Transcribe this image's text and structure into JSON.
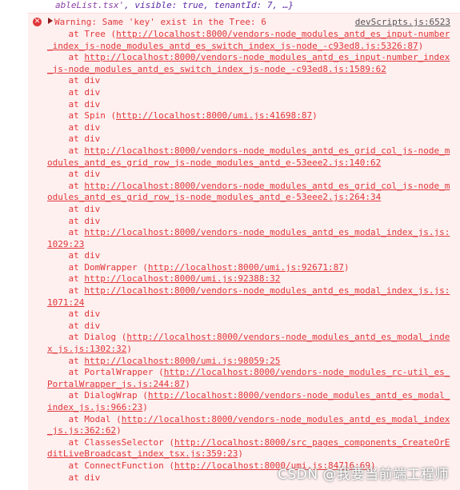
{
  "previous_line": {
    "text_a": "ableList.tsx'",
    "text_b": ", visible: true, tenantId: 7, …}"
  },
  "error": {
    "icon": "error-circle-icon",
    "headline": "Warning: Same 'key' exist in the Tree: 6",
    "source": "devScripts.js:6523",
    "frames": [
      {
        "fn": "Tree",
        "url": "http://localhost:8000/vendors-node_modules_antd_es_input-number_index_js-node_modules_antd_es_switch_index_js-node_-c93ed8.js:5326:87"
      },
      {
        "fn": "",
        "url": "http://localhost:8000/vendors-node_modules_antd_es_input-number_index_js-node_modules_antd_es_switch_index_js-node_-c93ed8.js:1589:62"
      },
      {
        "fn": "div",
        "url": ""
      },
      {
        "fn": "div",
        "url": ""
      },
      {
        "fn": "div",
        "url": ""
      },
      {
        "fn": "Spin",
        "url": "http://localhost:8000/umi.js:41698:87"
      },
      {
        "fn": "div",
        "url": ""
      },
      {
        "fn": "div",
        "url": ""
      },
      {
        "fn": "",
        "url": "http://localhost:8000/vendors-node_modules_antd_es_grid_col_js-node_modules_antd_es_grid_row_js-node_modules_antd_e-53eee2.js:140:62"
      },
      {
        "fn": "div",
        "url": ""
      },
      {
        "fn": "",
        "url": "http://localhost:8000/vendors-node_modules_antd_es_grid_col_js-node_modules_antd_es_grid_row_js-node_modules_antd_e-53eee2.js:264:34"
      },
      {
        "fn": "div",
        "url": ""
      },
      {
        "fn": "div",
        "url": ""
      },
      {
        "fn": "",
        "url": "http://localhost:8000/vendors-node_modules_antd_es_modal_index_js.js:1029:23"
      },
      {
        "fn": "div",
        "url": ""
      },
      {
        "fn": "DomWrapper",
        "url": "http://localhost:8000/umi.js:92671:87"
      },
      {
        "fn": "",
        "url": "http://localhost:8000/umi.js:92388:32"
      },
      {
        "fn": "",
        "url": "http://localhost:8000/vendors-node_modules_antd_es_modal_index_js.js:1071:24"
      },
      {
        "fn": "div",
        "url": ""
      },
      {
        "fn": "div",
        "url": ""
      },
      {
        "fn": "Dialog",
        "url": "http://localhost:8000/vendors-node_modules_antd_es_modal_index_js.js:1302:32"
      },
      {
        "fn": "",
        "url": "http://localhost:8000/umi.js:98059:25"
      },
      {
        "fn": "PortalWrapper",
        "url": "http://localhost:8000/vendors-node_modules_rc-util_es_PortalWrapper_js.js:244:87"
      },
      {
        "fn": "DialogWrap",
        "url": "http://localhost:8000/vendors-node_modules_antd_es_modal_index_js.js:966:23"
      },
      {
        "fn": "Modal",
        "url": "http://localhost:8000/vendors-node_modules_antd_es_modal_index_js.js:362:62"
      },
      {
        "fn": "ClassesSelector",
        "url": "http://localhost:8000/src_pages_components_CreateOrEditLiveBroadcast_index_tsx.js:359:23"
      },
      {
        "fn": "ConnectFunction",
        "url": "http://localhost:8000/umi.js:84716:69"
      },
      {
        "fn": "div",
        "url": ""
      }
    ]
  },
  "watermark": "CSDN @我要当前端工程师"
}
